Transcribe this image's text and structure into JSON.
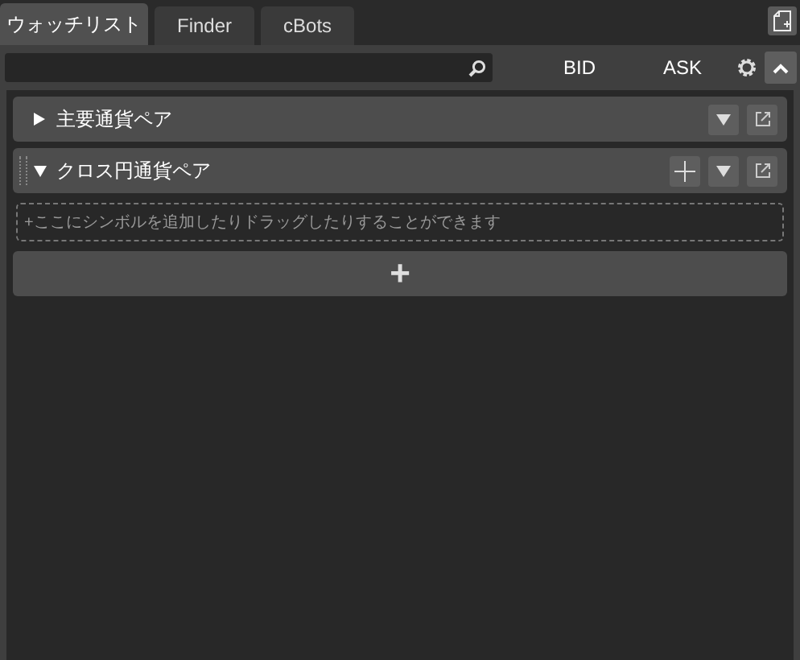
{
  "tabs": [
    {
      "label": "ウォッチリスト",
      "selected": true
    },
    {
      "label": "Finder",
      "selected": false
    },
    {
      "label": "cBots",
      "selected": false
    }
  ],
  "toolbar": {
    "columns": [
      "BID",
      "ASK"
    ]
  },
  "groups": [
    {
      "name": "主要通貨ペア",
      "expanded": false
    },
    {
      "name": "クロス円通貨ペア",
      "expanded": true,
      "drop_hint": "+ここにシンボルを追加したりドラッグしたりすることができます"
    }
  ],
  "add_button": "+"
}
